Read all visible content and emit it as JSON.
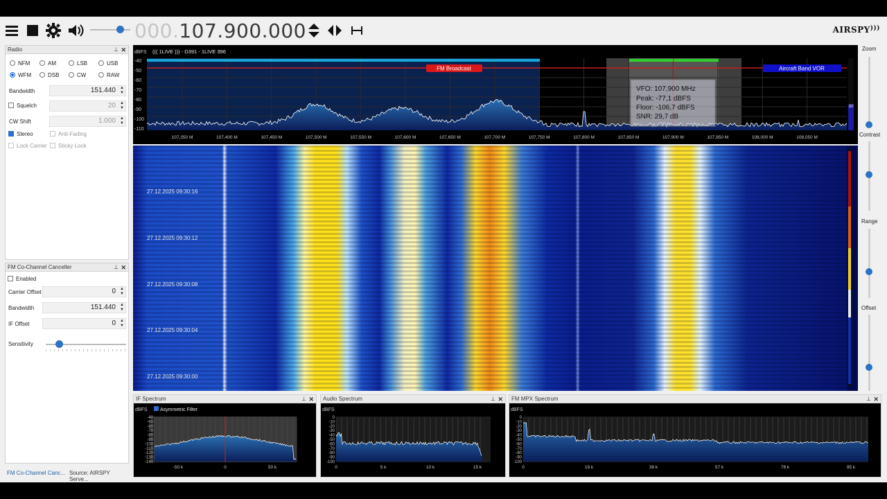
{
  "toolbar": {
    "frequency_dim": "000.",
    "frequency_main": "107.900.000",
    "logo": "AIRSPY"
  },
  "radio": {
    "title": "Radio",
    "modes": [
      {
        "label": "NFM",
        "selected": false
      },
      {
        "label": "AM",
        "selected": false
      },
      {
        "label": "LSB",
        "selected": false
      },
      {
        "label": "USB",
        "selected": false
      },
      {
        "label": "WFM",
        "selected": true
      },
      {
        "label": "DSB",
        "selected": false
      },
      {
        "label": "CW",
        "selected": false
      },
      {
        "label": "RAW",
        "selected": false
      }
    ],
    "bandwidth_label": "Bandwidth",
    "bandwidth_value": "151.440",
    "squelch_label": "Squelch",
    "squelch_value": "20",
    "cwshift_label": "CW Shift",
    "cwshift_value": "1.000",
    "stereo_label": "Stereo",
    "antifading_label": "Anti-Fading",
    "lockcarrier_label": "Lock Carrier",
    "stickylock_label": "Sticky Lock"
  },
  "fmcc": {
    "title": "FM Co-Channel Canceller",
    "enabled_label": "Enabled",
    "carrier_offset_label": "Carrier Offset",
    "carrier_offset_value": "0",
    "bandwidth_label": "Bandwidth",
    "bandwidth_value": "151.440",
    "if_offset_label": "IF Offset",
    "if_offset_value": "0",
    "sensitivity_label": "Sensitivity"
  },
  "tabs": {
    "tab1": "FM Co-Channel Canc...",
    "tab2": "Source: AIRSPY Serve..."
  },
  "spectrum": {
    "unit": "dBFS",
    "rds": "((( 1LIVE    ))) - D391 - 1LIVE 396",
    "y_ticks": [
      "-40",
      "-50",
      "-60",
      "-70",
      "-80",
      "-90",
      "-100",
      "-110"
    ],
    "x_ticks": [
      "107,350 M",
      "107,400 M",
      "107,450 M",
      "107,500 M",
      "107,550 M",
      "107,600 M",
      "107,650 M",
      "107,700 M",
      "107,750 M",
      "107,800 M",
      "107,850 M",
      "107,900 M",
      "107,950 M",
      "108,000 M",
      "108,050 M"
    ],
    "band_fm": "FM Broadcast",
    "band_air": "Aircraft Band VOR",
    "scale_value": "30",
    "tooltip": {
      "vfo": "VFO:  107,900 MHz",
      "peak": "Peak:  -77,1 dBFS",
      "floor": "Floor:  -106,7 dBFS",
      "snr": "SNR:   29,7 dB"
    }
  },
  "waterfall": {
    "timestamps": [
      "27.12.2025 09:30:16",
      "27.12.2025 09:30:12",
      "27.12.2025 09:30:08",
      "27.12.2025 09:30:04",
      "27.12.2025 09:30:00"
    ]
  },
  "right_controls": {
    "zoom": "Zoom",
    "contrast": "Contrast",
    "range": "Range",
    "offset": "Offset"
  },
  "if_spectrum": {
    "title": "IF Spectrum",
    "unit": "dBFS",
    "asym_label": "Asymmetric Filter",
    "y_ticks": [
      "-40",
      "-50",
      "-60",
      "-70",
      "-80",
      "-90",
      "-100",
      "-110",
      "-120",
      "-130",
      "-140"
    ],
    "x_ticks": [
      "-50 k",
      "0",
      "50 k"
    ]
  },
  "audio_spectrum": {
    "title": "Audio Spectrum",
    "unit": "dBFS",
    "y_ticks": [
      "0",
      "-10",
      "-20",
      "-30",
      "-40",
      "-50",
      "-60",
      "-70",
      "-80",
      "-90",
      "-100"
    ],
    "x_ticks": [
      "0",
      "5 k",
      "10 k",
      "15 k"
    ]
  },
  "mpx_spectrum": {
    "title": "FM MPX Spectrum",
    "unit": "dBFS",
    "y_ticks": [
      "0",
      "-10",
      "-20",
      "-30",
      "-40",
      "-50",
      "-60",
      "-70",
      "-80",
      "-90",
      "-100"
    ],
    "x_ticks": [
      "0",
      "19 k",
      "38 k",
      "57 k",
      "76 k",
      "95 k"
    ]
  }
}
